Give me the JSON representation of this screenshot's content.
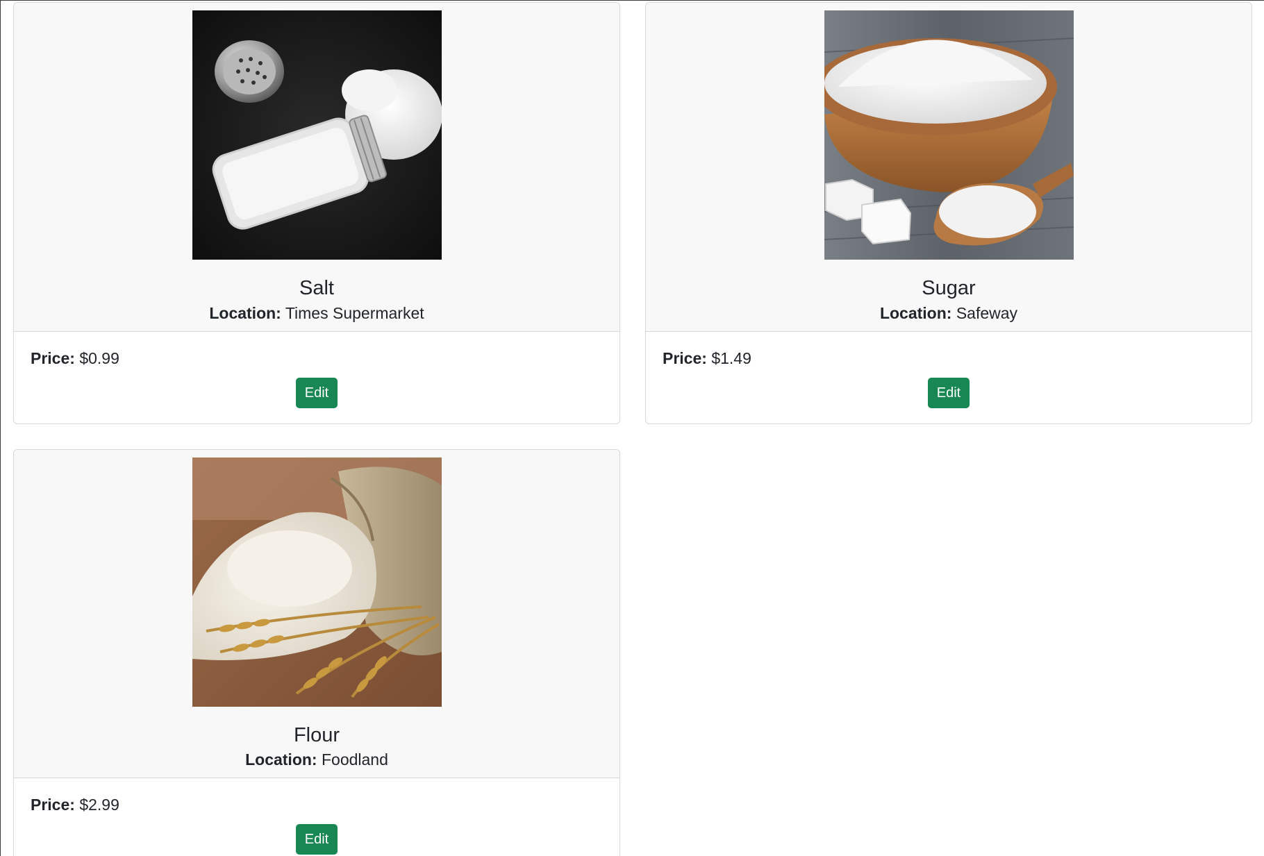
{
  "products": [
    {
      "name": "Salt",
      "location_label": "Location:",
      "location": "Times Supermarket",
      "price_label": "Price:",
      "price": "$0.99",
      "edit_label": "Edit",
      "image_icon": "salt-shaker-photo"
    },
    {
      "name": "Sugar",
      "location_label": "Location:",
      "location": "Safeway",
      "price_label": "Price:",
      "price": "$1.49",
      "edit_label": "Edit",
      "image_icon": "sugar-bowl-photo"
    },
    {
      "name": "Flour",
      "location_label": "Location:",
      "location": "Foodland",
      "price_label": "Price:",
      "price": "$2.99",
      "edit_label": "Edit",
      "image_icon": "flour-sack-photo"
    }
  ],
  "colors": {
    "button_bg": "#198754",
    "card_header_bg": "#f8f8f8",
    "card_border": "#d6d8db"
  }
}
